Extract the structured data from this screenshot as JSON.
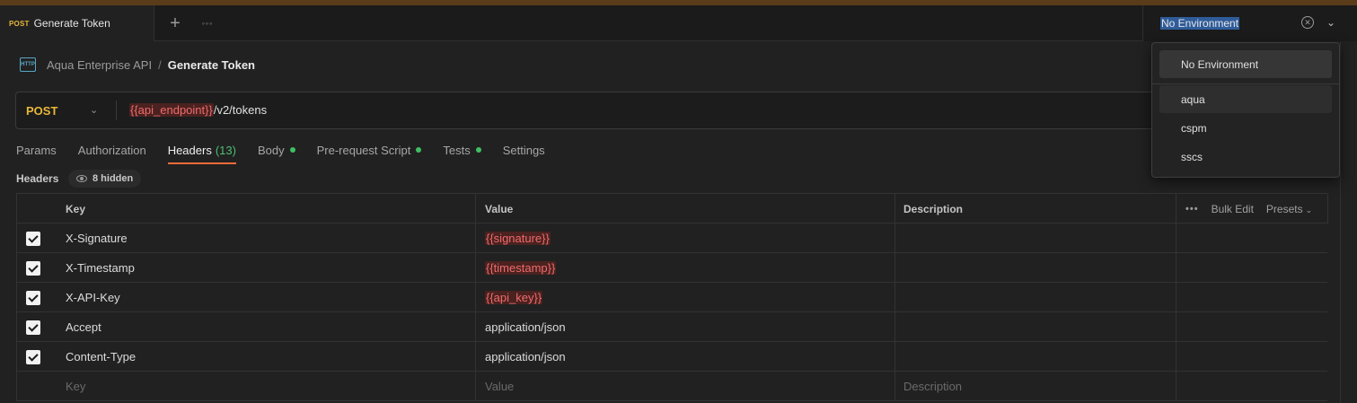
{
  "tab": {
    "method": "POST",
    "title": "Generate Token"
  },
  "tabbar": {
    "new_tab": "+",
    "more": "◦◦◦"
  },
  "environment": {
    "selected": "No Environment",
    "options": [
      "No Environment",
      "aqua",
      "cspm",
      "sscs"
    ]
  },
  "breadcrumb": {
    "icon_label": "HTTP",
    "collection": "Aqua Enterprise API",
    "separator": "/",
    "request": "Generate Token"
  },
  "request": {
    "method": "POST",
    "url_variable": "{{api_endpoint}}",
    "url_path": "/v2/tokens"
  },
  "request_tabs": [
    {
      "label": "Params"
    },
    {
      "label": "Authorization"
    },
    {
      "label": "Headers",
      "count": "(13)"
    },
    {
      "label": "Body"
    },
    {
      "label": "Pre-request Script"
    },
    {
      "label": "Tests"
    },
    {
      "label": "Settings"
    }
  ],
  "headers_section": {
    "label": "Headers",
    "hidden": "8 hidden"
  },
  "table": {
    "columns": [
      "Key",
      "Value",
      "Description"
    ],
    "actions": {
      "more": "•••",
      "bulk_edit": "Bulk Edit",
      "presets": "Presets"
    },
    "rows": [
      {
        "key": "X-Signature",
        "value": "{{signature}}"
      },
      {
        "key": "X-Timestamp",
        "value": "{{timestamp}}"
      },
      {
        "key": "X-API-Key",
        "value": "{{api_key}}"
      },
      {
        "key": "Accept",
        "value": "application/json"
      },
      {
        "key": "Content-Type",
        "value": "application/json"
      }
    ],
    "placeholders": {
      "key": "Key",
      "value": "Value",
      "description": "Description"
    }
  },
  "colors": {
    "accent": "#f26b3a",
    "method": "#e8b73a",
    "variable": "#f06b6b",
    "dot": "#3fbf62"
  }
}
